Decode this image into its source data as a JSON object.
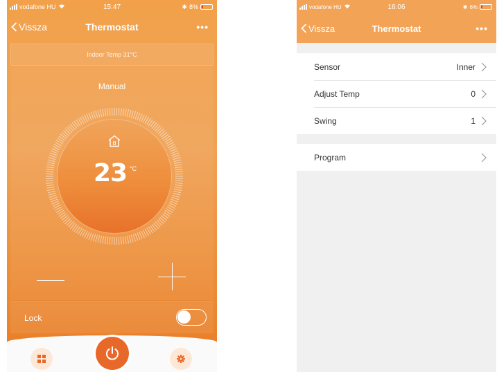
{
  "left_screen": {
    "status": {
      "carrier": "vodafone HU",
      "time": "15:47",
      "battery": "8%"
    },
    "nav": {
      "back_label": "Vissza",
      "title": "Thermostat",
      "more": "•••"
    },
    "indoor_temp": "Indoor Temp 31°C",
    "mode": "Manual",
    "setpoint": {
      "value": "23",
      "unit": "°C"
    },
    "lock": {
      "label": "Lock",
      "enabled": false
    },
    "tabs": {
      "home": "grid-icon",
      "power": "power-icon",
      "settings": "gear-icon"
    },
    "colors": {
      "accent": "#f0a255",
      "power": "#e8682a",
      "tab_bg": "#fde8d8"
    }
  },
  "right_screen": {
    "status": {
      "carrier": "vodafone HU",
      "time": "16:06",
      "battery": "6%"
    },
    "nav": {
      "back_label": "Vissza",
      "title": "Thermostat",
      "more": "•••"
    },
    "settings": [
      {
        "label": "Sensor",
        "value": "Inner"
      },
      {
        "label": "Adjust Temp",
        "value": "0"
      },
      {
        "label": "Swing",
        "value": "1"
      }
    ],
    "program": {
      "label": "Program",
      "value": ""
    },
    "colors": {
      "header": "#f2a356",
      "background": "#f0f0f0"
    }
  }
}
